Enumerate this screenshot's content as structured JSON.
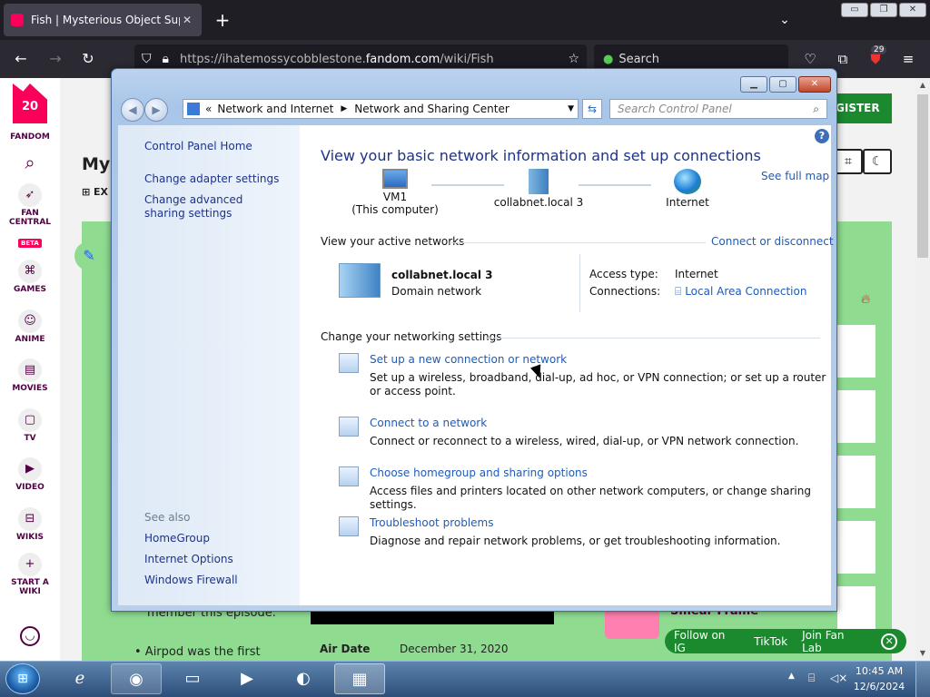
{
  "browser": {
    "tab_title": "Fish | Mysterious Object Super",
    "tab_close": "✕",
    "new_tab": "+",
    "tab_list": "⌄",
    "url_prefix": "https://ihatemossycobblestone.",
    "url_host": "fandom.com",
    "url_path": "/wiki/Fish",
    "search_placeholder": "Search",
    "ext_badge": "29",
    "win_min": "▭",
    "win_max": "❐",
    "win_close": "✕"
  },
  "fandom": {
    "logo_num": "20",
    "brand": "FANDOM",
    "nav": [
      {
        "label": "FAN\nCENTRAL"
      },
      {
        "label": "GAMES"
      },
      {
        "label": "ANIME"
      },
      {
        "label": "MOVIES"
      },
      {
        "label": "TV"
      },
      {
        "label": "VIDEO"
      },
      {
        "label": "WIKIS"
      },
      {
        "label": "START A\nWIKI"
      }
    ],
    "beta": "BETA",
    "page_head": "Mys",
    "page_sub": "EX",
    "register": "GISTER",
    "member_text": "member this episode.",
    "bullet_text": "• Airpod was the first",
    "air_date_label": "Air Date",
    "air_date_value": "December 31, 2020",
    "smear_title": "Smear Frame",
    "social": [
      "Follow on IG",
      "TikTok",
      "Join Fan Lab"
    ]
  },
  "control_panel": {
    "breadcrumb_prefix": "«",
    "breadcrumb": [
      "Network and Internet",
      "Network and Sharing Center"
    ],
    "search_placeholder": "Search Control Panel",
    "sidebar_links": [
      "Control Panel Home",
      "Change adapter settings",
      "Change advanced sharing settings"
    ],
    "see_also_label": "See also",
    "see_also_links": [
      "HomeGroup",
      "Internet Options",
      "Windows Firewall"
    ],
    "title": "View your basic network information and set up connections",
    "see_full_map": "See full map",
    "map": [
      {
        "name": "VM1",
        "sub": "(This computer)"
      },
      {
        "name": "collabnet.local  3",
        "sub": ""
      },
      {
        "name": "Internet",
        "sub": ""
      }
    ],
    "active_networks_heading": "View your active networks",
    "connect_or_disconnect": "Connect or disconnect",
    "active_network": {
      "name": "collabnet.local  3",
      "type": "Domain network",
      "access_type_label": "Access type:",
      "access_type_value": "Internet",
      "connections_label": "Connections:",
      "connections_value": "Local Area Connection"
    },
    "change_settings_heading": "Change your networking settings",
    "tasks": [
      {
        "link": "Set up a new connection or network",
        "desc": "Set up a wireless, broadband, dial-up, ad hoc, or VPN connection; or set up a router or access point."
      },
      {
        "link": "Connect to a network",
        "desc": "Connect or reconnect to a wireless, wired, dial-up, or VPN network connection."
      },
      {
        "link": "Choose homegroup and sharing options",
        "desc": "Access files and printers located on other network computers, or change sharing settings."
      },
      {
        "link": "Troubleshoot problems",
        "desc": "Diagnose and repair network problems, or get troubleshooting information."
      }
    ]
  },
  "taskbar": {
    "time": "10:45 AM",
    "date": "12/6/2024"
  }
}
